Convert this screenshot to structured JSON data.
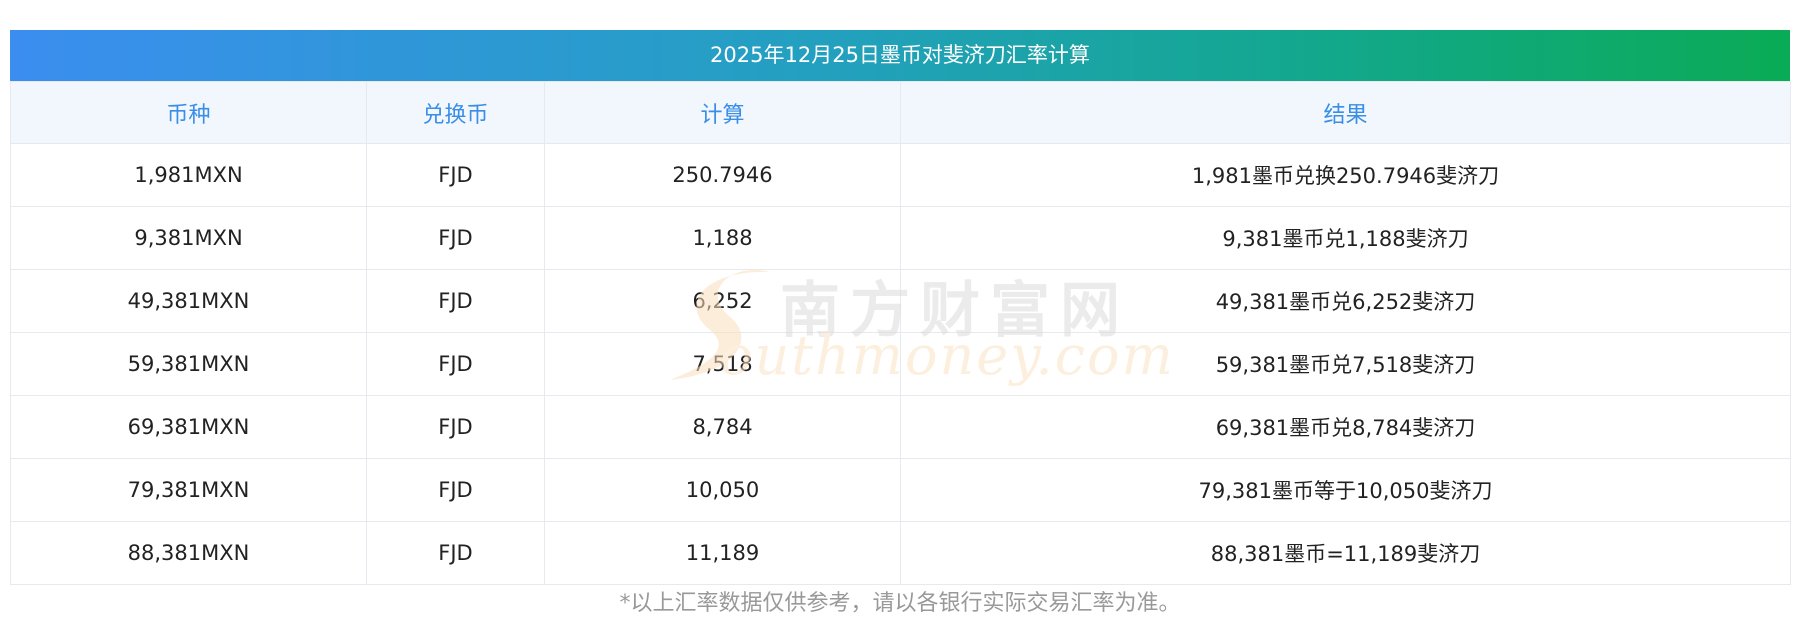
{
  "title": "2025年12月25日墨币对斐济刀汇率计算",
  "table": {
    "headers": [
      "币种",
      "兑换币",
      "计算",
      "结果"
    ],
    "rows": [
      [
        "1,981MXN",
        "FJD",
        "250.7946",
        "1,981墨币兑换250.7946斐济刀"
      ],
      [
        "9,381MXN",
        "FJD",
        "1,188",
        "9,381墨币兑1,188斐济刀"
      ],
      [
        "49,381MXN",
        "FJD",
        "6,252",
        "49,381墨币兑6,252斐济刀"
      ],
      [
        "59,381MXN",
        "FJD",
        "7,518",
        "59,381墨币兑7,518斐济刀"
      ],
      [
        "69,381MXN",
        "FJD",
        "8,784",
        "69,381墨币兑8,784斐济刀"
      ],
      [
        "79,381MXN",
        "FJD",
        "10,050",
        "79,381墨币等于10,050斐济刀"
      ],
      [
        "88,381MXN",
        "FJD",
        "11,189",
        "88,381墨币=11,189斐济刀"
      ]
    ]
  },
  "watermark": {
    "chinese": "南方财富网",
    "english": "outhmoney.com"
  },
  "footnote": "*以上汇率数据仅供参考，请以各银行实际交易汇率为准。",
  "colors": {
    "header_text": "#3a8ee6",
    "header_bg": "#f2f7fe",
    "banner_start": "#3b8ef0",
    "banner_end": "#0aab55"
  }
}
